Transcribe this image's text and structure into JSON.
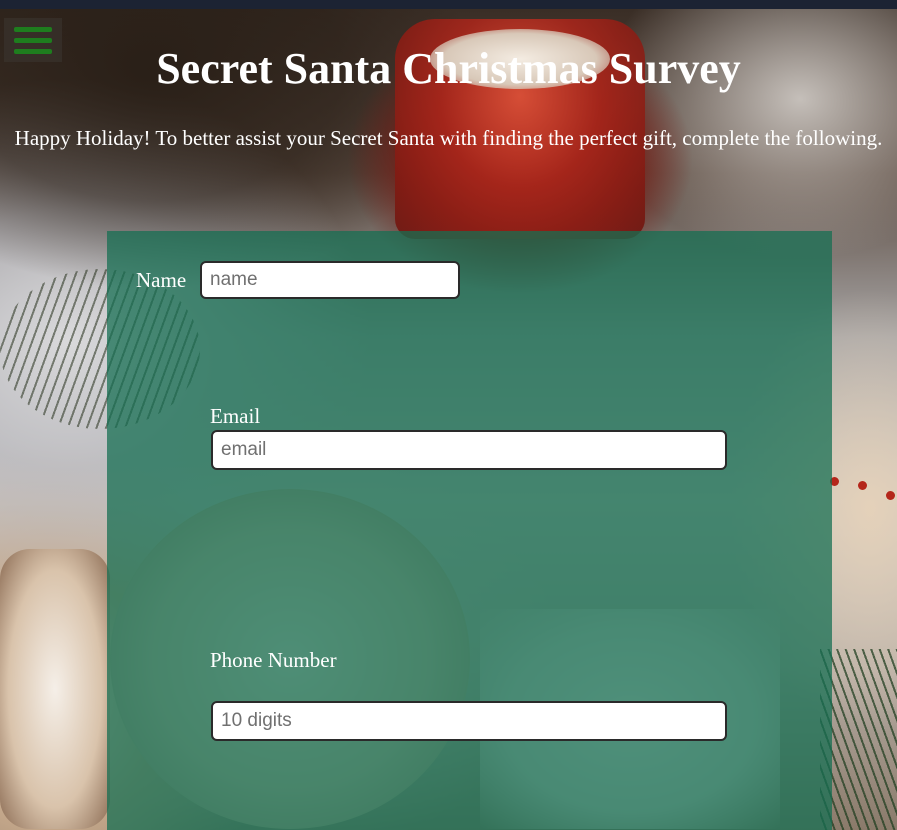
{
  "page": {
    "title": "Secret Santa Christmas Survey",
    "intro": "Happy Holiday! To better assist your Secret Santa with finding the perfect gift, complete the following."
  },
  "menu": {
    "icon": "hamburger-menu-icon",
    "color": "#1e7d1e"
  },
  "form": {
    "panel_color": "#156e52",
    "name": {
      "label": "Name",
      "placeholder": "name",
      "value": ""
    },
    "email": {
      "label": "Email",
      "placeholder": "email",
      "value": ""
    },
    "phone": {
      "label": "Phone Number",
      "placeholder": "10 digits",
      "value": ""
    }
  }
}
